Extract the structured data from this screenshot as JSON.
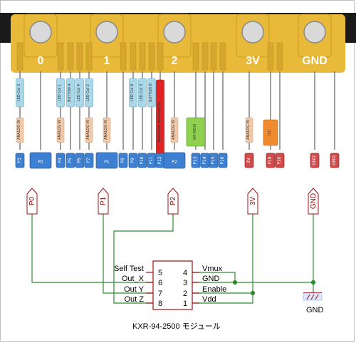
{
  "edge_connector": {
    "labels": [
      "0",
      "1",
      "2",
      "3V",
      "GND"
    ],
    "pins": [
      "P3",
      "P0",
      "P4",
      "P5",
      "P6",
      "P7",
      "P1",
      "P8",
      "P9",
      "P10",
      "P11",
      "P12",
      "P2",
      "P13",
      "P14",
      "P15",
      "P16",
      "3V",
      "P19",
      "P20",
      "GND",
      "GND"
    ],
    "functions": [
      {
        "pin": "P3",
        "text": "LED Col 3",
        "type": "led"
      },
      {
        "pin": "P4",
        "text": "LED Col 1",
        "type": "led"
      },
      {
        "pin": "P5",
        "text": "BUTTON A",
        "type": "led"
      },
      {
        "pin": "P6",
        "text": "LED Col 4",
        "type": "led"
      },
      {
        "pin": "P7",
        "text": "LED Col 2",
        "type": "led"
      },
      {
        "pin": "P9",
        "text": "LED Col 9",
        "type": "led"
      },
      {
        "pin": "P10",
        "text": "LED Col 3",
        "type": "led"
      },
      {
        "pin": "P11",
        "text": "BUTTON B",
        "type": "led"
      },
      {
        "pin": "P12",
        "text": "Reserved: accessibility",
        "type": "reserved"
      },
      {
        "pin": "P13",
        "text": "SPI MOSI",
        "type": "spi"
      },
      {
        "pin": "P19",
        "text": "I2C",
        "type": "i2c"
      }
    ],
    "analog_labels": [
      "ANALOG IN",
      "ANALOG IN",
      "ANALOG IN",
      "ANALOG IN",
      "ANALOG IN",
      "ANALOG IN"
    ]
  },
  "nets": [
    "P0",
    "P1",
    "P2",
    "3V",
    "GND"
  ],
  "module": {
    "left_labels": [
      "Self Test",
      "Out_X",
      "Out Y",
      "Out Z"
    ],
    "left_pins": [
      "5",
      "6",
      "7",
      "8"
    ],
    "right_pins": [
      "4",
      "3",
      "2",
      "1"
    ],
    "right_labels": [
      "Vmux",
      "GND",
      "Enable",
      "Vdd"
    ],
    "caption": "KXR-94-2500 モジュール"
  },
  "ground_symbol_label": "GND",
  "colors": {
    "board_gold": "#e9b93a",
    "board_black": "#1a1a1a",
    "pin_blue": "#3d7fd0",
    "pin_red": "#d24b4b",
    "wire_green": "#2e8b2e",
    "net_red": "#a01010"
  }
}
